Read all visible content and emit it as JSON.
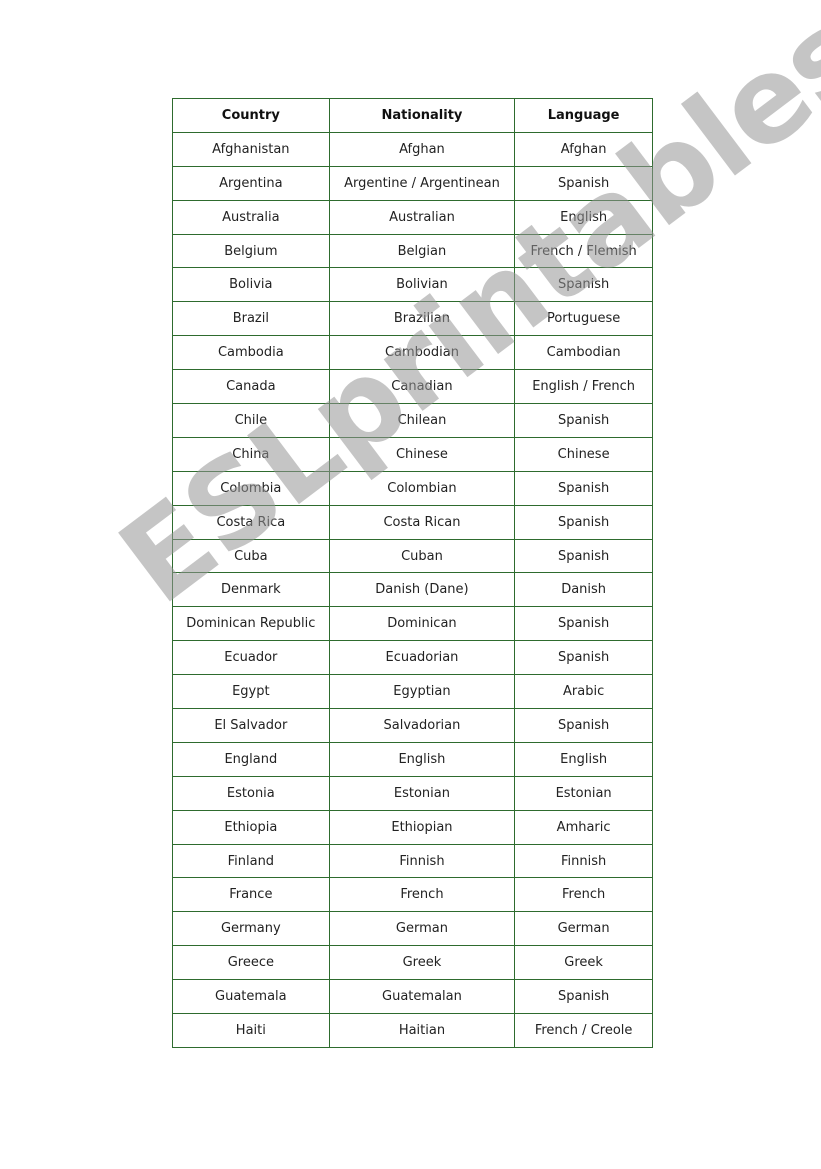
{
  "table": {
    "headers": [
      "Country",
      "Nationality",
      "Language"
    ],
    "rows": [
      [
        "Afghanistan",
        "Afghan",
        "Afghan"
      ],
      [
        "Argentina",
        "Argentine / Argentinean",
        "Spanish"
      ],
      [
        "Australia",
        "Australian",
        "English"
      ],
      [
        "Belgium",
        "Belgian",
        "French / Flemish"
      ],
      [
        "Bolivia",
        "Bolivian",
        "Spanish"
      ],
      [
        "Brazil",
        "Brazilian",
        "Portuguese"
      ],
      [
        "Cambodia",
        "Cambodian",
        "Cambodian"
      ],
      [
        "Canada",
        "Canadian",
        "English / French"
      ],
      [
        "Chile",
        "Chilean",
        "Spanish"
      ],
      [
        "China",
        "Chinese",
        "Chinese"
      ],
      [
        "Colombia",
        "Colombian",
        "Spanish"
      ],
      [
        "Costa Rica",
        "Costa Rican",
        "Spanish"
      ],
      [
        "Cuba",
        "Cuban",
        "Spanish"
      ],
      [
        "Denmark",
        "Danish (Dane)",
        "Danish"
      ],
      [
        "Dominican Republic",
        "Dominican",
        "Spanish"
      ],
      [
        "Ecuador",
        "Ecuadorian",
        "Spanish"
      ],
      [
        "Egypt",
        "Egyptian",
        "Arabic"
      ],
      [
        "El Salvador",
        "Salvadorian",
        "Spanish"
      ],
      [
        "England",
        "English",
        "English"
      ],
      [
        "Estonia",
        "Estonian",
        "Estonian"
      ],
      [
        "Ethiopia",
        "Ethiopian",
        "Amharic"
      ],
      [
        "Finland",
        "Finnish",
        "Finnish"
      ],
      [
        "France",
        "French",
        "French"
      ],
      [
        "Germany",
        "German",
        "German"
      ],
      [
        "Greece",
        "Greek",
        "Greek"
      ],
      [
        "Guatemala",
        "Guatemalan",
        "Spanish"
      ],
      [
        "Haiti",
        "Haitian",
        "French / Creole"
      ]
    ]
  },
  "watermark": "ESLprintables.com",
  "colors": {
    "border": "#2e6b2e"
  }
}
